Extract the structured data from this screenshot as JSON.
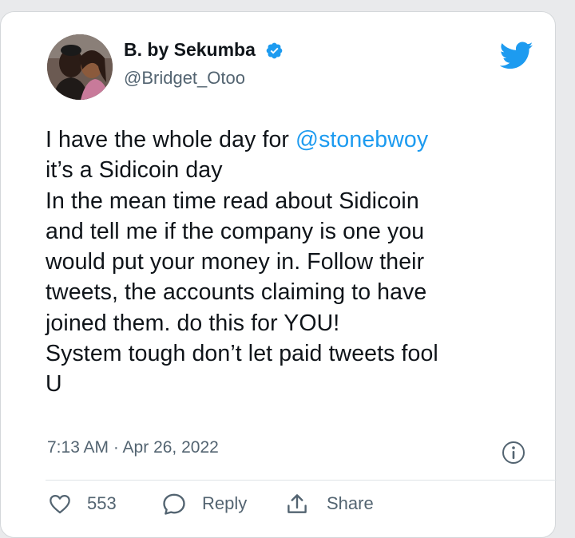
{
  "tweet": {
    "author_name": "B. by Sekumba",
    "author_handle": "@Bridget_Otoo",
    "text_lines": [
      [
        "I have the whole day for ",
        "@stonebwoy"
      ],
      [
        "it’s a Sidicoin day",
        ""
      ],
      [
        "In the mean time read about Sidicoin",
        ""
      ],
      [
        "and tell me if the company is one you",
        ""
      ],
      [
        "would put your money in. Follow their",
        ""
      ],
      [
        "tweets, the accounts claiming to have",
        ""
      ],
      [
        "joined them. do this for YOU!",
        ""
      ],
      [
        "System tough don’t let paid tweets fool",
        ""
      ],
      [
        "U",
        ""
      ]
    ],
    "timestamp": "7:13 AM · Apr 26, 2022",
    "like_count": "553",
    "reply_label": "Reply",
    "share_label": "Share"
  },
  "icons": {
    "verified": "verified-badge-icon",
    "brand": "twitter-bird-icon",
    "info": "info-icon",
    "like": "heart-icon",
    "reply": "speech-bubble-icon",
    "share": "share-upload-icon"
  },
  "colors": {
    "brand_blue": "#1d9bf0",
    "text": "#0f1419",
    "secondary": "#536471"
  }
}
